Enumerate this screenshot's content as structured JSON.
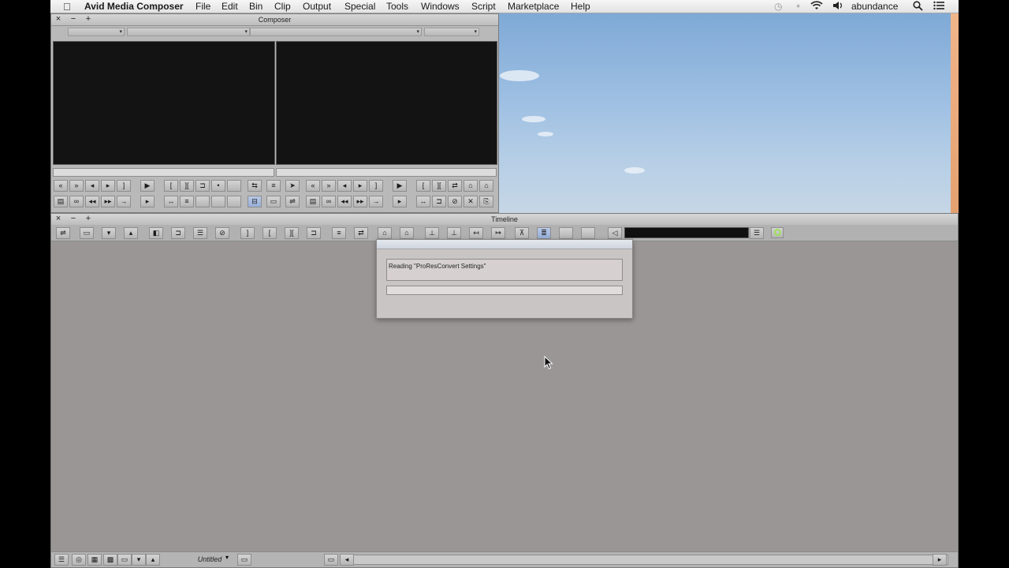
{
  "menubar": {
    "app_name": "Avid Media Composer",
    "items": [
      "File",
      "Edit",
      "Bin",
      "Clip",
      "Output",
      "Special",
      "Tools",
      "Windows",
      "Script",
      "Marketplace",
      "Help"
    ],
    "user": "abundance"
  },
  "composer": {
    "title": "Composer",
    "close": "×",
    "minimize": "−",
    "zoom": "+"
  },
  "timeline": {
    "title": "Timeline",
    "close": "×",
    "minimize": "−",
    "zoom": "+",
    "sequence_name": "Untitled"
  },
  "dialog": {
    "message": "Reading \"ProResConvert Settings\"",
    "progress_percent": 0
  },
  "colors": {
    "desktop_sky": "#9fc0e3",
    "panel": "#b9b9b9",
    "timeline_bg": "#9a9696",
    "selected_button": "#97aed8",
    "status_green": "#9ee05a"
  }
}
